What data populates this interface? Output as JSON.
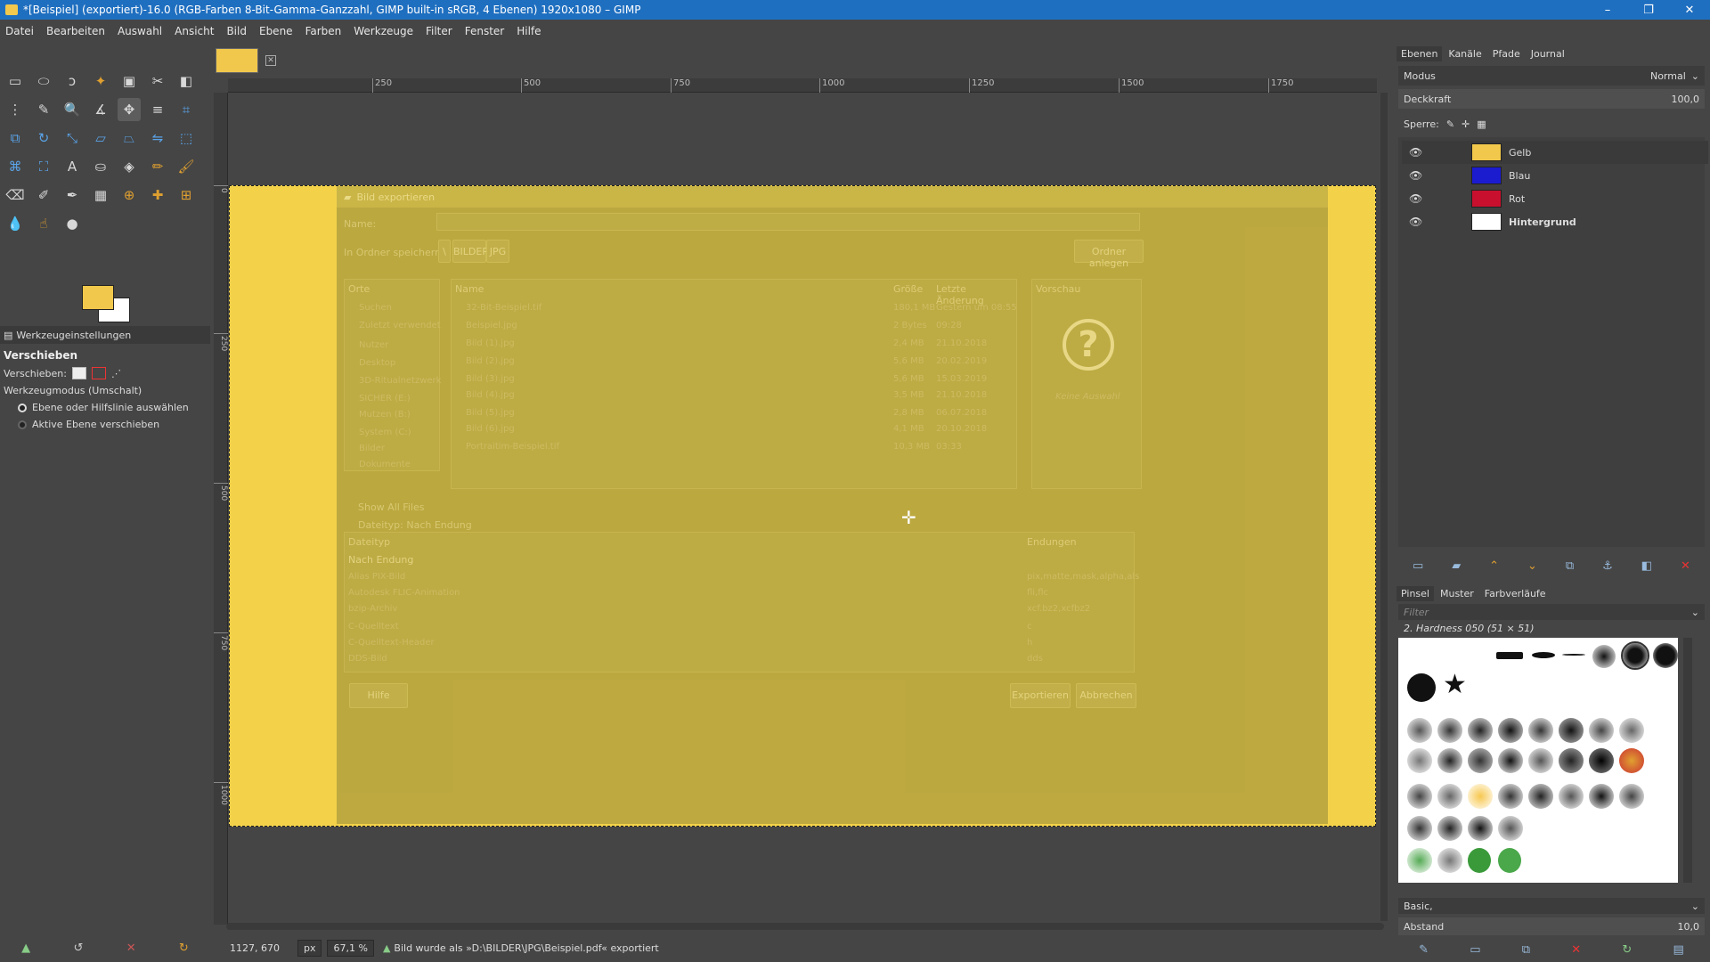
{
  "window": {
    "title": "*[Beispiel] (exportiert)-16.0 (RGB-Farben 8-Bit-Gamma-Ganzzahl, GIMP built-in sRGB, 4 Ebenen) 1920x1080 – GIMP",
    "minimize": "–",
    "maximize": "❐",
    "close": "✕"
  },
  "menu": [
    "Datei",
    "Bearbeiten",
    "Auswahl",
    "Ansicht",
    "Bild",
    "Ebene",
    "Farben",
    "Werkzeuge",
    "Filter",
    "Fenster",
    "Hilfe"
  ],
  "toolbox": {
    "tab_label": "Werkzeugeinstellungen",
    "tool_name": "Verschieben",
    "move_label": "Verschieben:",
    "mode_label": "Werkzeugmodus (Umschalt)",
    "option1": "Ebene oder Hilfslinie auswählen",
    "option2": "Aktive Ebene verschieben",
    "fg_color": "#f1c84b",
    "bg_color": "#ffffff"
  },
  "ruler": {
    "h_ticks": [
      "250",
      "500",
      "750",
      "1000",
      "1250",
      "1500",
      "1750"
    ],
    "v_ticks": [
      "0",
      "250",
      "500",
      "750",
      "1000"
    ]
  },
  "dialog": {
    "title": "Bild exportieren",
    "name_label": "Name:",
    "folder_label": "In Ordner speichern:",
    "crumb1": "\\",
    "crumb2": "BILDER",
    "crumb3": "JPG",
    "create_folder": "Ordner anlegen",
    "places_header": "Orte",
    "places": [
      "Suchen",
      "Zuletzt verwendet",
      "Nutzer",
      "Desktop",
      "3D-Ritualnetzwerk",
      "SICHER (E:)",
      "Mutzen (B:)",
      "System (C:)",
      "Bilder",
      "Dokumente"
    ],
    "col_name": "Name",
    "col_size": "Größe",
    "col_date": "Letzte Änderung",
    "files": [
      {
        "name": "32-Bit-Beispiel.tif",
        "size": "180,1 MB",
        "date": "Gestern um 08:55"
      },
      {
        "name": "Beispiel.jpg",
        "size": "2 Bytes",
        "date": "09:28"
      },
      {
        "name": "Bild (1).jpg",
        "size": "2,4 MB",
        "date": "21.10.2018"
      },
      {
        "name": "Bild (2).jpg",
        "size": "5,6 MB",
        "date": "20.02.2019"
      },
      {
        "name": "Bild (3).jpg",
        "size": "5,6 MB",
        "date": "15.03.2019"
      },
      {
        "name": "Bild (4).jpg",
        "size": "3,5 MB",
        "date": "21.10.2018"
      },
      {
        "name": "Bild (5).jpg",
        "size": "2,8 MB",
        "date": "06.07.2018"
      },
      {
        "name": "Bild (6).jpg",
        "size": "4,1 MB",
        "date": "20.10.2018"
      },
      {
        "name": "Portraitim-Beispiel.tif",
        "size": "10,3 MB",
        "date": "03:33"
      }
    ],
    "preview_header": "Vorschau",
    "no_selection": "Keine Auswahl",
    "show_all": "Show All Files",
    "filetype_toggle": "Dateityp: Nach Endung",
    "col_filetype": "Dateityp",
    "col_ext": "Endungen",
    "filetypes": [
      {
        "type": "Nach Endung",
        "ext": ""
      },
      {
        "type": "Alias PIX-Bild",
        "ext": "pix,matte,mask,alpha,als"
      },
      {
        "type": "Autodesk FLIC-Animation",
        "ext": "fli,flc"
      },
      {
        "type": "bzip-Archiv",
        "ext": "xcf.bz2,xcfbz2"
      },
      {
        "type": "C-Quelltext",
        "ext": "c"
      },
      {
        "type": "C-Quelltext-Header",
        "ext": "h"
      },
      {
        "type": "DDS-Bild",
        "ext": "dds"
      }
    ],
    "help": "Hilfe",
    "export": "Exportieren",
    "cancel": "Abbrechen"
  },
  "status": {
    "coords": "1127, 670",
    "unit": "px",
    "zoom": "67,1 %",
    "message": "Bild wurde als »D:\\BILDER\\JPG\\Beispiel.pdf« exportiert"
  },
  "layers_panel": {
    "tabs": [
      "Ebenen",
      "Kanäle",
      "Pfade",
      "Journal"
    ],
    "mode_label": "Modus",
    "mode_value": "Normal",
    "opacity_label": "Deckkraft",
    "opacity_value": "100,0",
    "lock_label": "Sperre:",
    "layers": [
      {
        "name": "Gelb",
        "color": "#f1c84b"
      },
      {
        "name": "Blau",
        "color": "#1b1bd0"
      },
      {
        "name": "Rot",
        "color": "#c8102e"
      },
      {
        "name": "Hintergrund",
        "color": "#ffffff"
      }
    ]
  },
  "brushes_panel": {
    "tabs": [
      "Pinsel",
      "Muster",
      "Farbverläufe"
    ],
    "filter_placeholder": "Filter",
    "selected_brush": "2. Hardness 050 (51 × 51)",
    "tag": "Basic,",
    "spacing_label": "Abstand",
    "spacing_value": "10,0"
  }
}
